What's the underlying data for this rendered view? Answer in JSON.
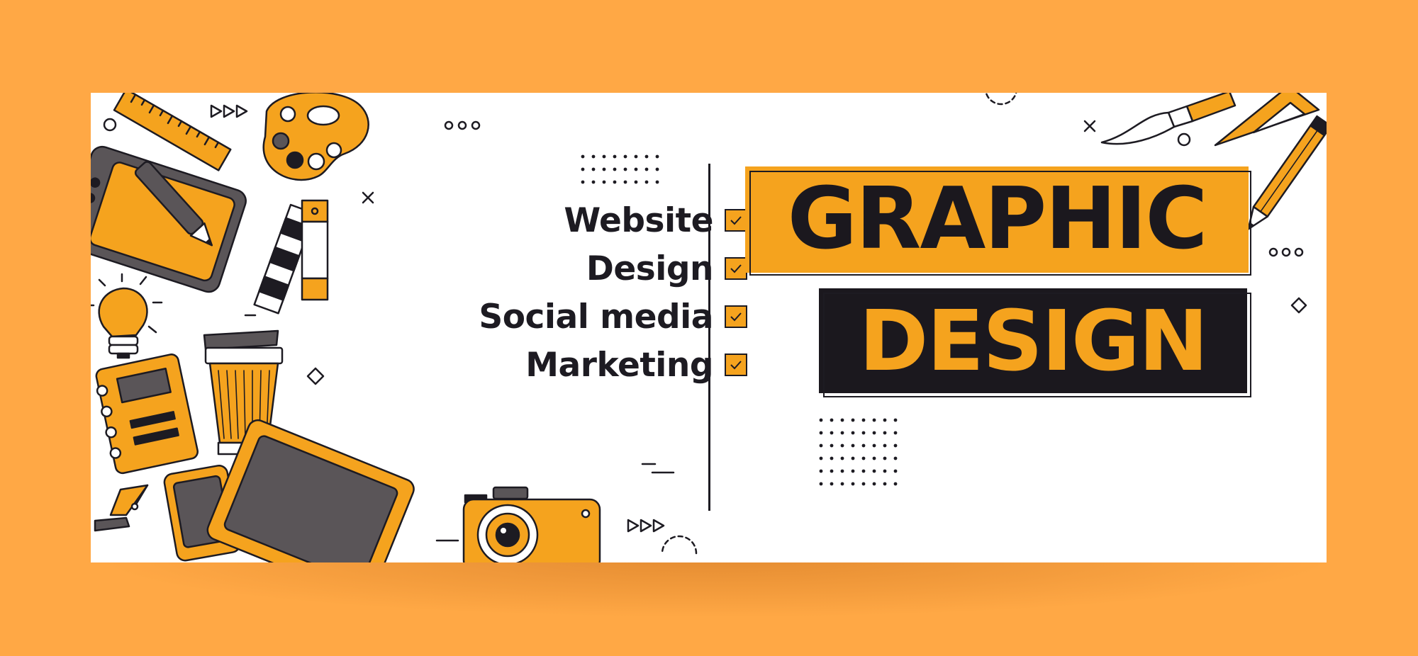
{
  "banner": {
    "services": [
      {
        "label": "Website",
        "checked": true
      },
      {
        "label": "Design",
        "checked": true
      },
      {
        "label": "Social media",
        "checked": true
      },
      {
        "label": "Marketing",
        "checked": true
      }
    ],
    "title": {
      "line1": "GRAPHIC",
      "line2": "DESIGN"
    },
    "colors": {
      "background": "#FFA845",
      "accent": "#F5A31E",
      "dark": "#1b181e",
      "panel": "#ffffff"
    },
    "icons": [
      "ruler-icon",
      "palette-icon",
      "drawing-tablet-icon",
      "stylus-pen-icon",
      "color-swatch-icon",
      "light-bulb-icon",
      "coffee-cup-icon",
      "notebook-icon",
      "fountain-pen-nib-icon",
      "smartphone-icon",
      "monitor-icon",
      "camera-icon",
      "paintbrush-icon",
      "set-square-icon",
      "pencil-icon"
    ]
  }
}
